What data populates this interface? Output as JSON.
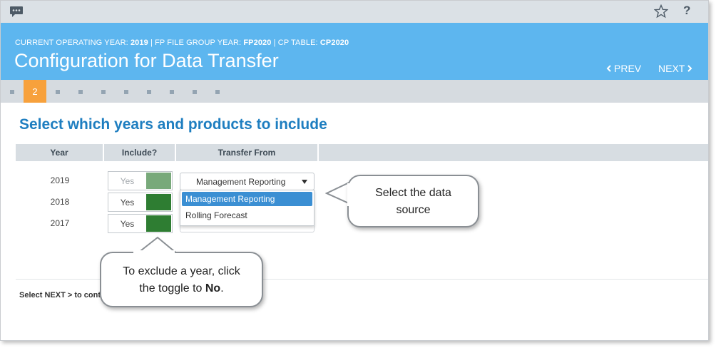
{
  "topbar": {
    "chat_icon": "chat-bubble-icon",
    "star_icon": "star-icon",
    "help_label": "?"
  },
  "header": {
    "year_label": "CURRENT OPERATING YEAR:",
    "year_value": "2019",
    "sep1": " | ",
    "fp_label": "FP FILE GROUP YEAR:",
    "fp_value": "FP2020",
    "sep2": " | ",
    "cp_label": "CP TABLE:",
    "cp_value": "CP2020",
    "title": "Configuration for Data Transfer",
    "prev_label": "PREV",
    "next_label": "NEXT"
  },
  "steps": {
    "active_step": "2"
  },
  "section": {
    "title": "Select which years and products to include"
  },
  "table": {
    "headers": [
      "Year",
      "Include?",
      "Transfer From"
    ],
    "rows": [
      {
        "year": "2019",
        "toggle": "Yes"
      },
      {
        "year": "2018",
        "toggle": "Yes"
      },
      {
        "year": "2017",
        "toggle": "Yes"
      }
    ]
  },
  "select": {
    "value": "Management Reporting",
    "options": [
      "Management Reporting",
      "Rolling Forecast"
    ]
  },
  "footer": {
    "text": "Select NEXT > to cont"
  },
  "callouts": {
    "data_source": "Select the data source",
    "exclude_line1": "To exclude a year, click",
    "exclude_line2_pre": "the toggle to ",
    "exclude_line2_bold": "No",
    "exclude_line2_post": "."
  },
  "colors": {
    "header_bg": "#5db6ef",
    "accent_step": "#f7a13c",
    "title_blue": "#1e7ec0",
    "toggle_on": "#2e7d32",
    "option_selected": "#3b8fd3"
  }
}
